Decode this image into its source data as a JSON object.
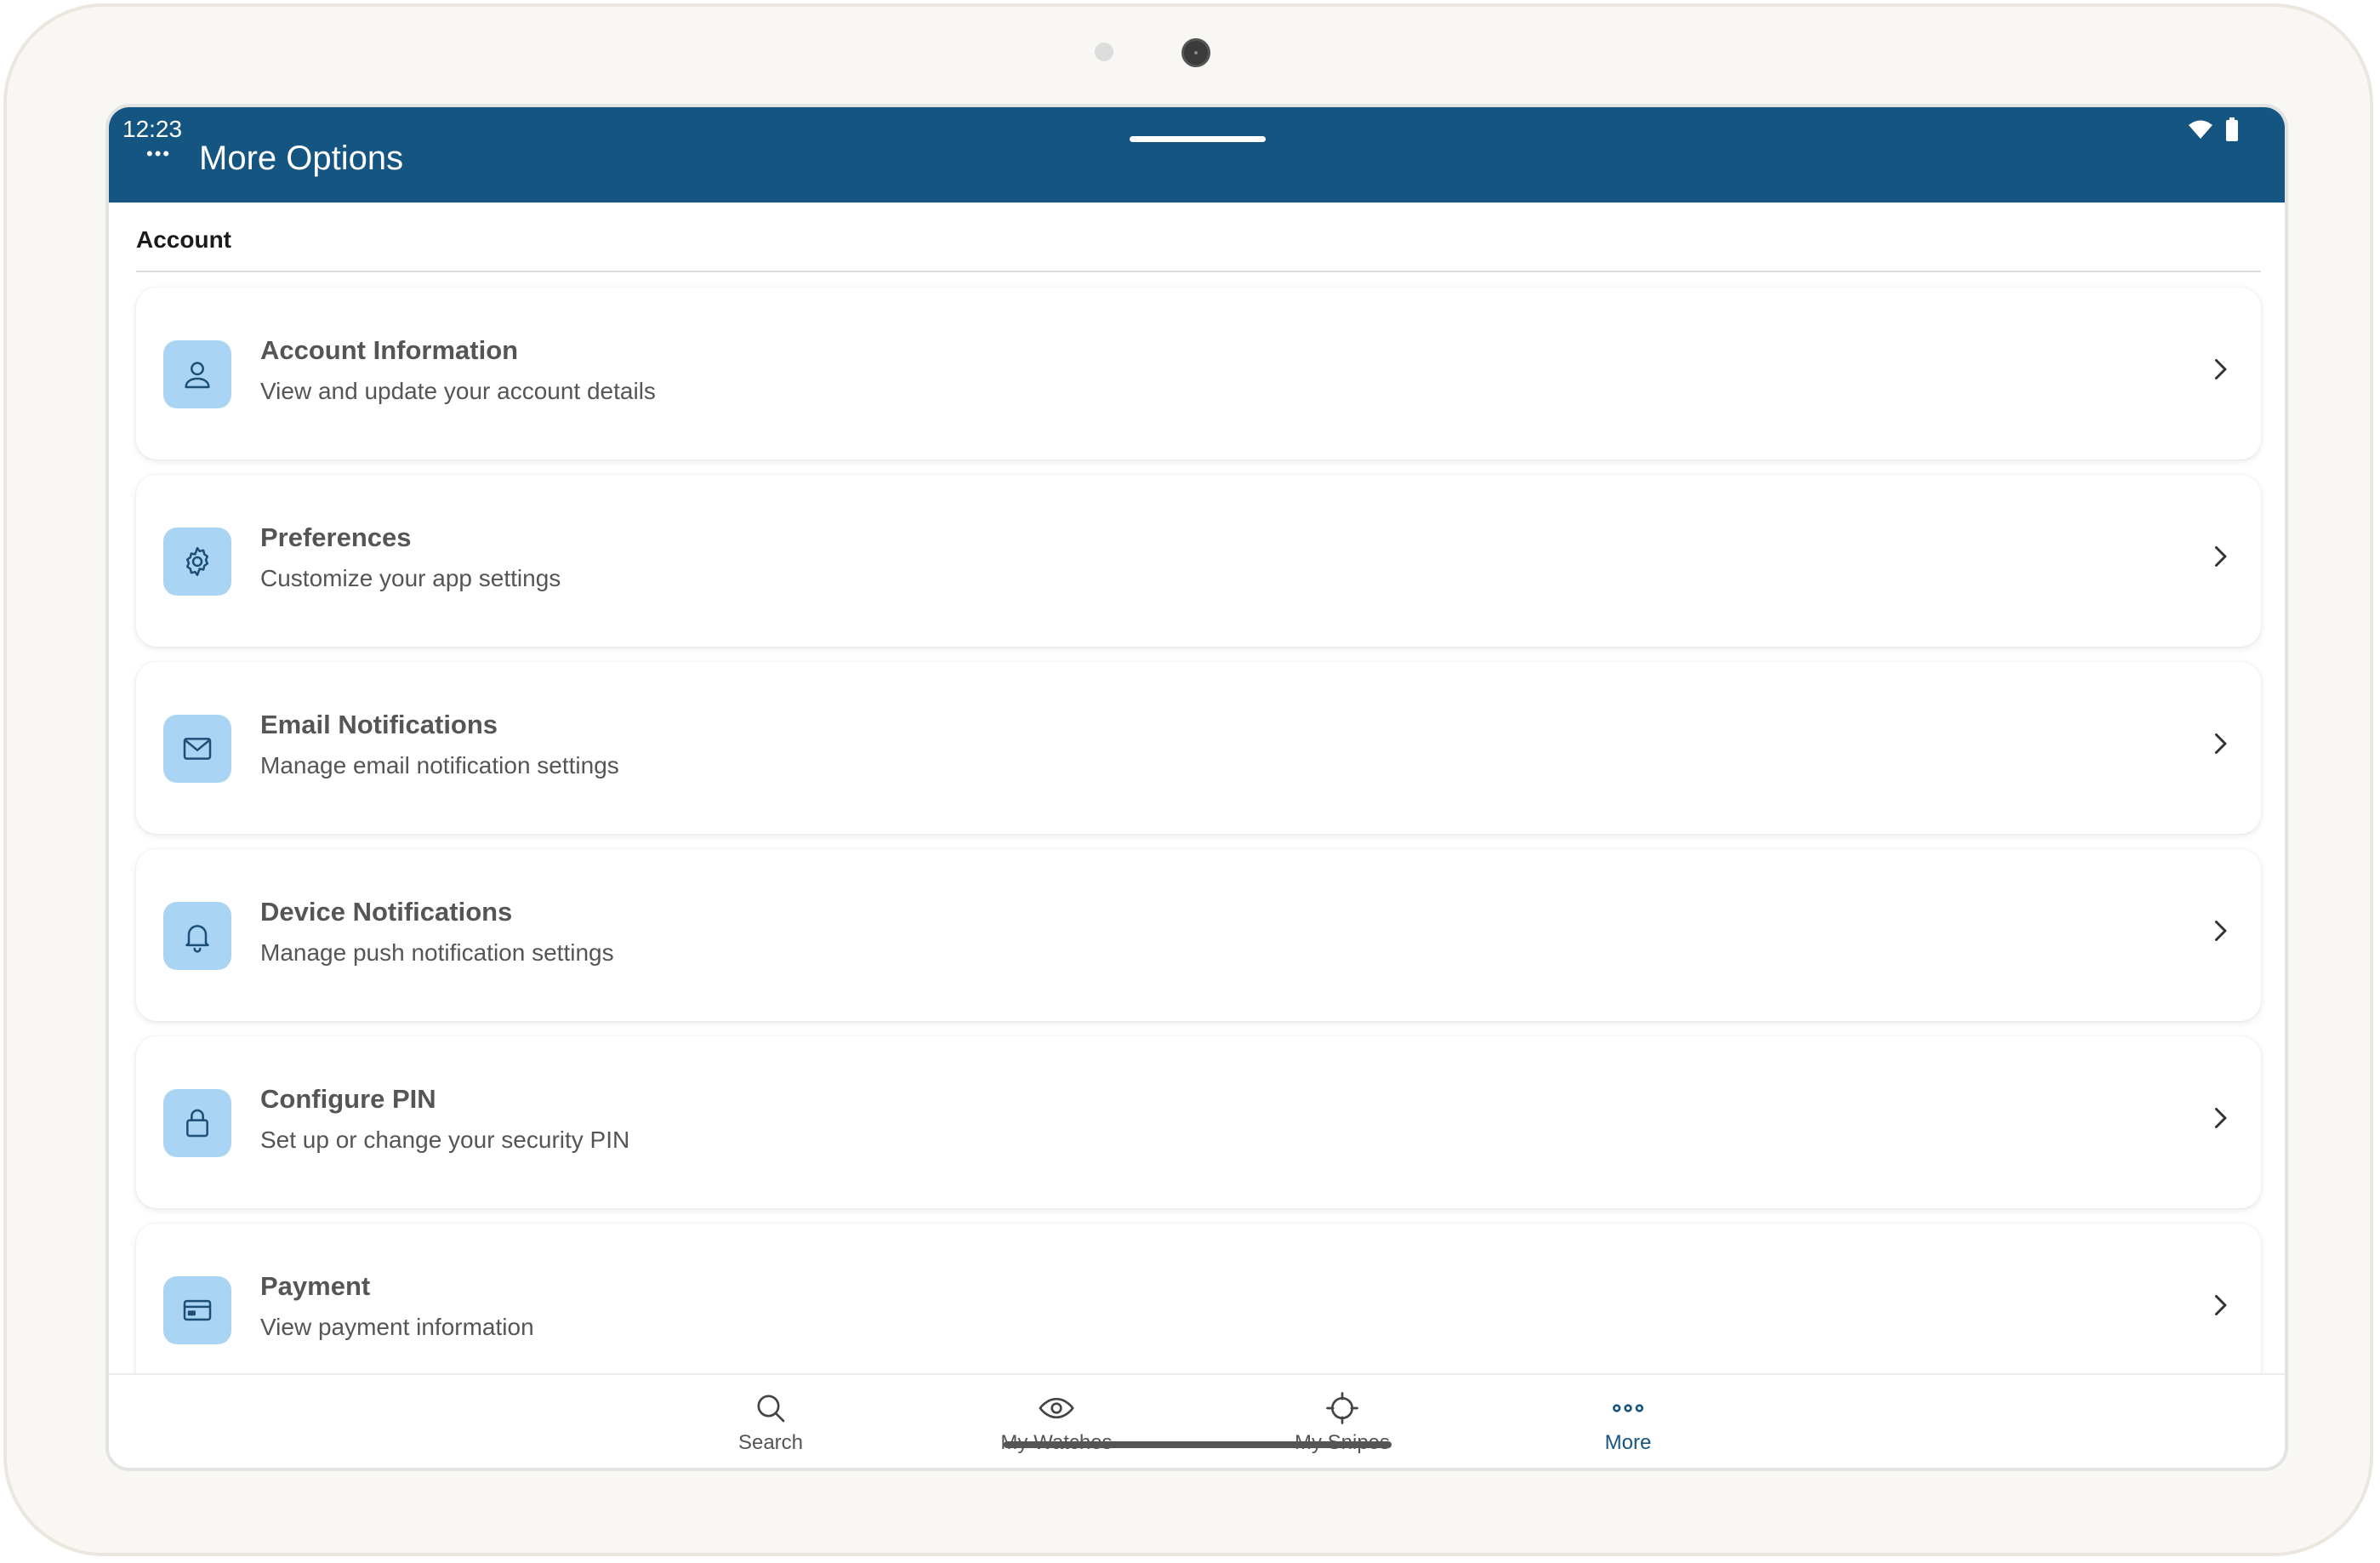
{
  "status_bar": {
    "time": "12:23"
  },
  "app_bar": {
    "menu_dots": "•••",
    "title": "More Options"
  },
  "section": {
    "title": "Account"
  },
  "items": [
    {
      "title": "Account Information",
      "subtitle": "View and update your account details",
      "icon": "user-icon"
    },
    {
      "title": "Preferences",
      "subtitle": "Customize your app settings",
      "icon": "gear-icon"
    },
    {
      "title": "Email Notifications",
      "subtitle": "Manage email notification settings",
      "icon": "mail-icon"
    },
    {
      "title": "Device Notifications",
      "subtitle": "Manage push notification settings",
      "icon": "bell-icon"
    },
    {
      "title": "Configure PIN",
      "subtitle": "Set up or change your security PIN",
      "icon": "lock-icon"
    },
    {
      "title": "Payment",
      "subtitle": "View payment information",
      "icon": "credit-card-icon"
    }
  ],
  "bottom_nav": [
    {
      "label": "Search",
      "icon": "search-icon"
    },
    {
      "label": "My Watches",
      "icon": "eye-icon"
    },
    {
      "label": "My Snipes",
      "icon": "crosshair-icon"
    },
    {
      "label": "More",
      "icon": "more-dots-icon",
      "active": true
    }
  ],
  "colors": {
    "primary": "#155582",
    "icon_bg": "#a9d4f3",
    "text_muted": "#555555"
  }
}
